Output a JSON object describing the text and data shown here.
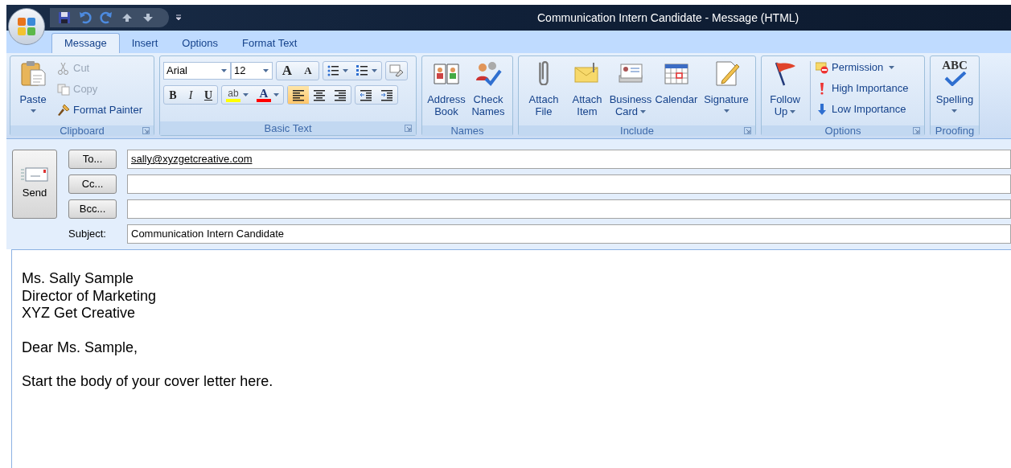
{
  "window": {
    "title": "Communication Intern Candidate - Message (HTML)"
  },
  "tabs": [
    {
      "label": "Message",
      "selected": true
    },
    {
      "label": "Insert",
      "selected": false
    },
    {
      "label": "Options",
      "selected": false
    },
    {
      "label": "Format Text",
      "selected": false
    }
  ],
  "clipboard": {
    "label": "Clipboard",
    "launcher": true,
    "paste": {
      "lines": [
        "Paste"
      ],
      "dropdown": true
    },
    "items": [
      {
        "label": "Cut",
        "disabled": true
      },
      {
        "label": "Copy",
        "disabled": true
      },
      {
        "label": "Format Painter",
        "disabled": false
      }
    ]
  },
  "basic_text": {
    "label": "Basic Text",
    "launcher": true,
    "font": "Arial",
    "size": "12",
    "size_buttons": [
      {
        "kind": "grow",
        "glyph": "A"
      },
      {
        "kind": "shrink",
        "glyph": "A"
      }
    ],
    "list_buttons": [
      {
        "kind": "bullets",
        "dropdown": true
      },
      {
        "kind": "numbering",
        "dropdown": true
      }
    ],
    "style_buttons": [
      {
        "kind": "bold",
        "glyph": "B"
      },
      {
        "kind": "italic",
        "glyph": "I"
      },
      {
        "kind": "underline",
        "glyph": "U"
      }
    ],
    "color_buttons": [
      {
        "kind": "highlight",
        "glyph": "ab",
        "color": "#ffff00",
        "dropdown": true
      },
      {
        "kind": "font_color",
        "glyph": "A",
        "color": "#ff0000",
        "dropdown": true
      }
    ],
    "align_buttons": [
      {
        "kind": "left",
        "selected": true
      },
      {
        "kind": "center",
        "selected": false
      },
      {
        "kind": "right",
        "selected": false
      }
    ],
    "indent_buttons": [
      {
        "kind": "decrease"
      },
      {
        "kind": "increase"
      }
    ]
  },
  "names": {
    "label": "Names",
    "launcher": false,
    "buttons": [
      {
        "lines": [
          "Address",
          "Book"
        ],
        "dropdown": false
      },
      {
        "lines": [
          "Check",
          "Names"
        ],
        "dropdown": false
      }
    ]
  },
  "include": {
    "label": "Include",
    "launcher": true,
    "buttons": [
      {
        "lines": [
          "Attach",
          "File"
        ],
        "dropdown": false
      },
      {
        "lines": [
          "Attach",
          "Item"
        ],
        "dropdown": false
      },
      {
        "lines": [
          "Business",
          "Card"
        ],
        "dropdown": true
      },
      {
        "lines": [
          "Calendar"
        ],
        "dropdown": false
      },
      {
        "lines": [
          "Signature"
        ],
        "dropdown": true
      }
    ]
  },
  "options": {
    "label": "Options",
    "launcher": true,
    "follow_up": {
      "lines": [
        "Follow",
        "Up"
      ],
      "dropdown": true
    },
    "items": [
      {
        "label": "Permission",
        "dropdown": true
      },
      {
        "label": "High Importance",
        "dropdown": false
      },
      {
        "label": "Low Importance",
        "dropdown": false
      }
    ]
  },
  "proofing": {
    "label": "Proofing",
    "launcher": false,
    "spelling": {
      "lines": [
        "Spelling"
      ],
      "dropdown": true,
      "icon_text": "ABC"
    }
  },
  "send": {
    "label": "Send"
  },
  "recipients": [
    {
      "button": "To...",
      "value": "sally@xyzgetcreative.com"
    },
    {
      "button": "Cc..."
    },
    {
      "button": "Bcc..."
    }
  ],
  "subject": {
    "label": "Subject:",
    "value": "Communication Intern Candidate"
  },
  "body": {
    "paragraphs": [
      [
        "Ms. Sally Sample",
        "Director of Marketing",
        "XYZ Get Creative"
      ],
      [
        "Dear Ms. Sample,"
      ],
      [
        "Start the body of your cover letter here."
      ]
    ]
  }
}
